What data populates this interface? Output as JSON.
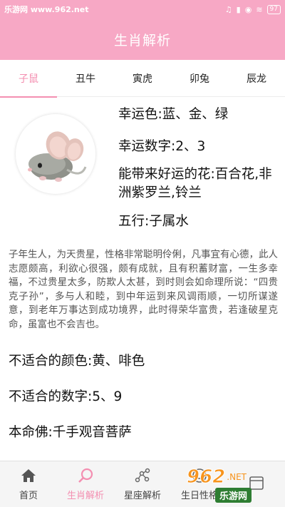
{
  "status_bar": {
    "site": "乐游网 www.962.net",
    "battery": "97"
  },
  "header": {
    "title": "生肖解析"
  },
  "tabs": [
    {
      "label": "子鼠",
      "active": true
    },
    {
      "label": "丑牛",
      "active": false
    },
    {
      "label": "寅虎",
      "active": false
    },
    {
      "label": "卯兔",
      "active": false
    },
    {
      "label": "辰龙",
      "active": false
    }
  ],
  "zodiac": {
    "icon": "mouse-avatar",
    "lucky_color": "幸运色:蓝、金、绿",
    "lucky_number": "幸运数字:2、3",
    "lucky_flower": "能带来好运的花:百合花,非洲紫罗兰,铃兰",
    "element": "五行:子属水",
    "description": "子年生人，为天贵星，性格非常聪明伶俐，凡事宜有心德，此人志愿颇高，利欲心很强，颇有成就，且有积蓄财富，一生多幸福，不过贵星太多，防欺人太甚，到时则会如命理所说：“四贵克子孙”，多与人和睦，到中年运到来风调雨顺，一切所谋遂意，到老年万事达到成功境界，此时得荣华富贵，若逢破星克命，虽富也不会吉也。",
    "unlucky_color": "不适合的颜色:黄、啡色",
    "unlucky_number": "不适合的数字:5、9",
    "patron_buddha": "本命佛:千手观音菩萨"
  },
  "bottom_nav": [
    {
      "label": "首页",
      "icon": "home-icon",
      "active": false
    },
    {
      "label": "生肖解析",
      "icon": "search-icon",
      "active": true
    },
    {
      "label": "星座解析",
      "icon": "constellation-icon",
      "active": false
    },
    {
      "label": "生日性格",
      "icon": "smile-icon",
      "active": false
    },
    {
      "label": "",
      "icon": "calendar-icon",
      "active": false
    }
  ],
  "watermark": {
    "logo": "962",
    "text": "乐游网"
  },
  "colors": {
    "accent": "#f48fb1",
    "header": "#f7a8c5"
  }
}
